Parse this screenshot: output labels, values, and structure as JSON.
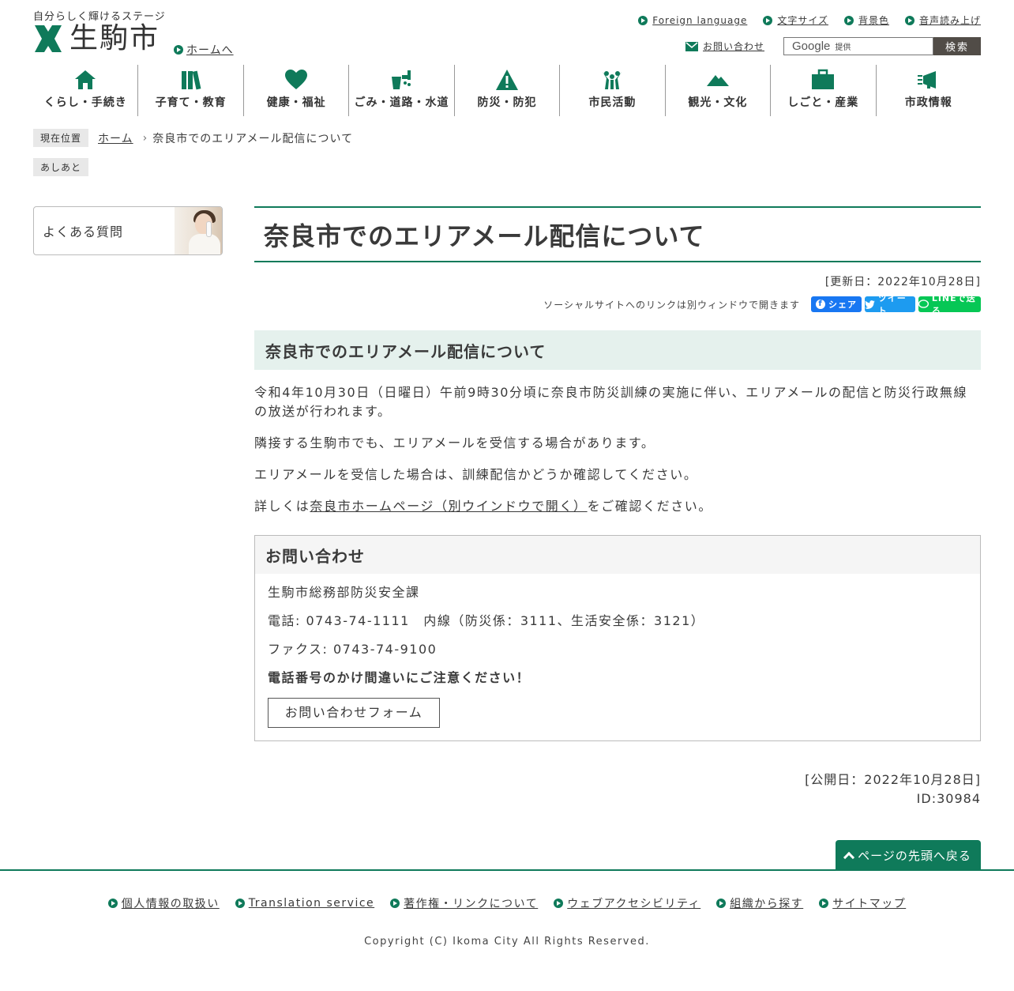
{
  "header": {
    "tagline": "自分らしく輝けるステージ",
    "city_name": "生駒市",
    "home_link": "ホームへ",
    "utility": [
      "Foreign language",
      "文字サイズ",
      "背景色",
      "音声読み上げ"
    ],
    "contact_link": "お問い合わせ",
    "search": {
      "google": "Google",
      "provided": "提供",
      "button": "検索"
    }
  },
  "nav": [
    {
      "label": "くらし・手続き",
      "icon": "house-icon"
    },
    {
      "label": "子育て・教育",
      "icon": "books-icon"
    },
    {
      "label": "健康・福祉",
      "icon": "heart-icon"
    },
    {
      "label": "ごみ・道路・水道",
      "icon": "faucet-icon"
    },
    {
      "label": "防災・防犯",
      "icon": "warning-icon"
    },
    {
      "label": "市民活動",
      "icon": "people-icon"
    },
    {
      "label": "観光・文化",
      "icon": "mountain-icon"
    },
    {
      "label": "しごと・産業",
      "icon": "briefcase-icon"
    },
    {
      "label": "市政情報",
      "icon": "megaphone-icon"
    }
  ],
  "breadcrumb": {
    "current_label": "現在位置",
    "home": "ホーム",
    "current": "奈良市でのエリアメール配信について",
    "ashiato": "あしあと"
  },
  "side": {
    "faq": "よくある質問"
  },
  "article": {
    "title": "奈良市でのエリアメール配信について",
    "updated": "[更新日：2022年10月28日]",
    "social_note": "ソーシャルサイトへのリンクは別ウィンドウで開きます",
    "social": {
      "facebook": "シェア",
      "twitter": "ツイート",
      "line": "LINEで送る"
    },
    "heading": "奈良市でのエリアメール配信について",
    "p1": "令和4年10月30日（日曜日）午前9時30分頃に奈良市防災訓練の実施に伴い、エリアメールの配信と防災行政無線の放送が行われます。",
    "p2": "隣接する生駒市でも、エリアメールを受信する場合があります。",
    "p3": "エリアメールを受信した場合は、訓練配信かどうか確認してください。",
    "p4_prefix": "詳しくは",
    "p4_link": "奈良市ホームページ（別ウインドウで開く）",
    "p4_suffix": "をご確認ください。",
    "published": "[公開日：2022年10月28日]",
    "id": "ID:30984"
  },
  "contact": {
    "heading": "お問い合わせ",
    "dept": "生駒市総務部防災安全課",
    "tel": "電話: 0743-74-1111　内線（防災係：3111、生活安全係：3121）",
    "fax": "ファクス: 0743-74-9100",
    "warning": "電話番号のかけ間違いにご注意ください！",
    "form_button": "お問い合わせフォーム"
  },
  "footer": {
    "page_top": "ページの先頭へ戻る",
    "links": [
      "個人情報の取扱い",
      "Translation service",
      "著作権・リンクについて",
      "ウェブアクセシビリティ",
      "組織から探す",
      "サイトマップ"
    ],
    "copyright": "Copyright (C) Ikoma City All Rights Reserved."
  },
  "colors": {
    "brand_green": "#0f7a5a",
    "h2_bg": "#e5f1ed",
    "search_btn": "#514c47"
  }
}
